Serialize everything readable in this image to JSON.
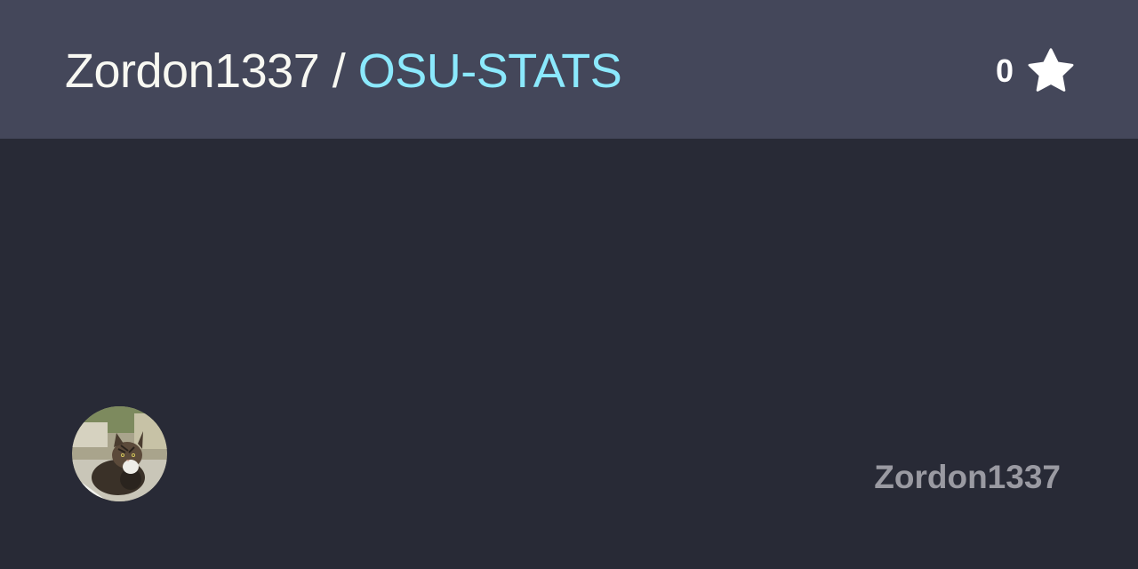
{
  "header": {
    "owner": "Zordon1337",
    "separator": "/",
    "repo": "OSU-STATS",
    "star_count": "0",
    "star_icon": "star-icon"
  },
  "footer": {
    "avatar_icon": "cat-avatar",
    "username": "Zordon1337"
  },
  "colors": {
    "header_bg": "#44475a",
    "page_bg": "#282a36",
    "repo_accent": "#8be9fd",
    "owner_text": "#f8f8f2",
    "username_text": "#9a9aa2"
  }
}
